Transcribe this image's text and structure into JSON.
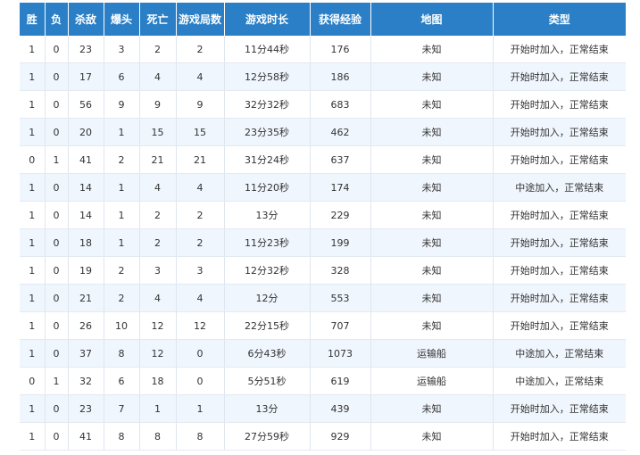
{
  "headers": [
    "胜",
    "负",
    "杀敌",
    "爆头",
    "死亡",
    "游戏局数",
    "游戏时长",
    "获得经验",
    "地图",
    "类型"
  ],
  "rows": [
    [
      "1",
      "0",
      "23",
      "3",
      "2",
      "2",
      "11分44秒",
      "176",
      "未知",
      "开始时加入，正常结束"
    ],
    [
      "1",
      "0",
      "17",
      "6",
      "4",
      "4",
      "12分58秒",
      "186",
      "未知",
      "开始时加入，正常结束"
    ],
    [
      "1",
      "0",
      "56",
      "9",
      "9",
      "9",
      "32分32秒",
      "683",
      "未知",
      "开始时加入，正常结束"
    ],
    [
      "1",
      "0",
      "20",
      "1",
      "15",
      "15",
      "23分35秒",
      "462",
      "未知",
      "开始时加入，正常结束"
    ],
    [
      "0",
      "1",
      "41",
      "2",
      "21",
      "21",
      "31分24秒",
      "637",
      "未知",
      "开始时加入，正常结束"
    ],
    [
      "1",
      "0",
      "14",
      "1",
      "4",
      "4",
      "11分20秒",
      "174",
      "未知",
      "中途加入，正常结束"
    ],
    [
      "1",
      "0",
      "14",
      "1",
      "2",
      "2",
      "13分",
      "229",
      "未知",
      "开始时加入，正常结束"
    ],
    [
      "1",
      "0",
      "18",
      "1",
      "2",
      "2",
      "11分23秒",
      "199",
      "未知",
      "开始时加入，正常结束"
    ],
    [
      "1",
      "0",
      "19",
      "2",
      "3",
      "3",
      "12分32秒",
      "328",
      "未知",
      "开始时加入，正常结束"
    ],
    [
      "1",
      "0",
      "21",
      "2",
      "4",
      "4",
      "12分",
      "553",
      "未知",
      "开始时加入，正常结束"
    ],
    [
      "1",
      "0",
      "26",
      "10",
      "12",
      "12",
      "22分15秒",
      "707",
      "未知",
      "开始时加入，正常结束"
    ],
    [
      "1",
      "0",
      "37",
      "8",
      "12",
      "0",
      "6分43秒",
      "1073",
      "运输船",
      "中途加入，正常结束"
    ],
    [
      "0",
      "1",
      "32",
      "6",
      "18",
      "0",
      "5分51秒",
      "619",
      "运输船",
      "中途加入，正常结束"
    ],
    [
      "1",
      "0",
      "23",
      "7",
      "1",
      "1",
      "13分",
      "439",
      "未知",
      "开始时加入，正常结束"
    ],
    [
      "1",
      "0",
      "41",
      "8",
      "8",
      "8",
      "27分59秒",
      "929",
      "未知",
      "开始时加入，正常结束"
    ]
  ],
  "colors": {
    "header_bg": "#2a7fc6",
    "header_text": "#ffffff",
    "row_alt_bg": "#f0f6fd",
    "cell_text": "#333333"
  }
}
